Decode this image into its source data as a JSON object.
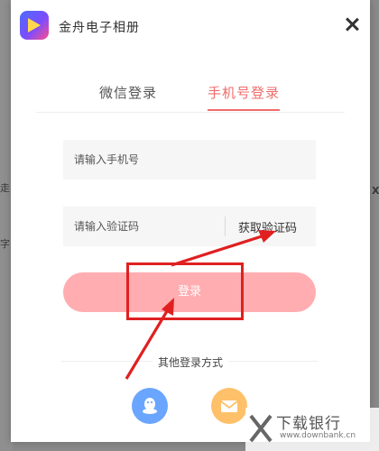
{
  "app": {
    "title": "金舟电子相册"
  },
  "tabs": [
    {
      "label": "微信登录",
      "active": false
    },
    {
      "label": "手机号登录",
      "active": true
    }
  ],
  "form": {
    "phone_placeholder": "请输入手机号",
    "code_placeholder": "请输入验证码",
    "get_code_label": "获取验证码",
    "login_label": "登录"
  },
  "other": {
    "label": "其他登录方式",
    "methods": [
      "qq-icon",
      "mail-icon"
    ]
  },
  "background": {
    "glyph_1": "走",
    "glyph_2": "字",
    "glyph_3": "X"
  },
  "watermark": {
    "text": "下载银行",
    "url": "www.downbank.cn"
  },
  "colors": {
    "accent": "#f06c6c",
    "login_button": "#ffadb1",
    "annotation": "#e02020",
    "qq": "#6aa6ff",
    "mail": "#ffc06a"
  }
}
